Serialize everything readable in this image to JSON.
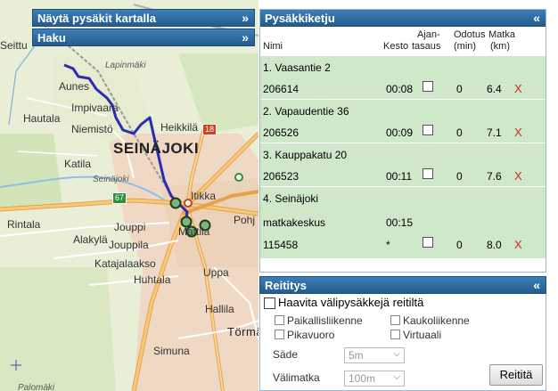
{
  "map": {
    "panels": {
      "show_stops_label": "Näytä pysäkit kartalla",
      "search_label": "Haku",
      "chevron": "»"
    },
    "labels": {
      "seittu": "Seittu",
      "aunes": "Aunes",
      "lapinmaki": "Lapinmäki",
      "impivaara": "Impivaara",
      "hautala": "Hautala",
      "niemisto": "Niemistö",
      "heikkila": "Heikkilä",
      "seinajoki": "SEINÄJOKI",
      "katila": "Katila",
      "seinajoki_river": "Seinäjoki",
      "itikka": "Itikka",
      "pohja": "Pohj",
      "rintala": "Rintala",
      "jouppi": "Jouppi",
      "mattila": "Mattila",
      "alakyla": "Alakylä",
      "jouppila": "Jouppila",
      "katajalaakso": "Katajalaakso",
      "uppa": "Uppa",
      "huhtala": "Huhtala",
      "hallila": "Hallila",
      "tormava": "Törmävä",
      "simuna": "Simuna",
      "palomaki": "Palomäki",
      "road_18": "18",
      "road_67": "67"
    }
  },
  "stops_panel": {
    "title": "Pysäkkiketju",
    "collapse": "«",
    "columns": {
      "name": "Nimi",
      "duration": "Kesto",
      "timing_1": "Ajan-",
      "timing_2": "tasaus",
      "wait_1": "Odotus",
      "wait_2": "(min)",
      "distance_1": "Matka",
      "distance_2": "(km)"
    },
    "stops": [
      {
        "name": "1. Vaasantie 2",
        "code": "206614",
        "duration": "00:08",
        "wait": "0",
        "distance": "6.4",
        "delete": "X"
      },
      {
        "name": "2. Vapaudentie 36",
        "code": "206526",
        "duration": "00:09",
        "wait": "0",
        "distance": "7.1",
        "delete": "X"
      },
      {
        "name": "3. Kauppakatu 20",
        "code": "206523",
        "duration": "00:11",
        "wait": "0",
        "distance": "7.6",
        "delete": "X"
      },
      {
        "name": "4. Seinäjoki",
        "name_2": "matkakeskus",
        "code": "115458",
        "duration": "00:15",
        "duration_2": "*",
        "wait": "0",
        "distance": "8.0",
        "delete": "X"
      }
    ]
  },
  "routing_panel": {
    "title": "Reititys",
    "collapse": "«",
    "hide_stops_label": "Haavita välipysäkkejä reitiltä",
    "options": {
      "local": "Paikallisliikenne",
      "long_distance": "Kaukoliikenne",
      "express": "Pikavuoro",
      "virtual": "Virtuaali"
    },
    "radius_label": "Säde",
    "radius_value": "5m",
    "interval_label": "Välimatka",
    "interval_value": "100m",
    "route_button": "Reititä"
  }
}
